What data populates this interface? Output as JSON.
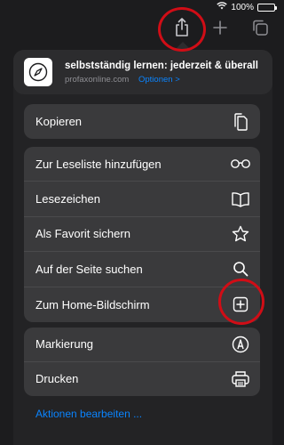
{
  "status_bar": {
    "battery_text": "100%"
  },
  "toolbar": {
    "share_icon": "share-icon",
    "new_tab_icon": "plus-icon",
    "tabs_icon": "tabs-overview-icon"
  },
  "header": {
    "title": "selbstständig lernen: jederzeit & überall",
    "domain": "profaxonline.com",
    "options_label": "Optionen >"
  },
  "groups": [
    {
      "items": [
        {
          "label": "Kopieren",
          "icon": "copy-icon"
        }
      ]
    },
    {
      "items": [
        {
          "label": "Zur Leseliste hinzufügen",
          "icon": "reading-list-icon"
        },
        {
          "label": "Lesezeichen",
          "icon": "bookmark-book-icon"
        },
        {
          "label": "Als Favorit sichern",
          "icon": "star-icon"
        },
        {
          "label": "Auf der Seite suchen",
          "icon": "search-icon"
        },
        {
          "label": "Zum Home-Bildschirm",
          "icon": "add-square-icon"
        }
      ]
    },
    {
      "items": [
        {
          "label": "Markierung",
          "icon": "markup-icon"
        },
        {
          "label": "Drucken",
          "icon": "printer-icon"
        }
      ]
    }
  ],
  "footer": {
    "edit_actions_label": "Aktionen bearbeiten ..."
  },
  "colors": {
    "accent": "#0a84ff",
    "highlight": "#d00d16",
    "background": "#1c1c1e"
  }
}
